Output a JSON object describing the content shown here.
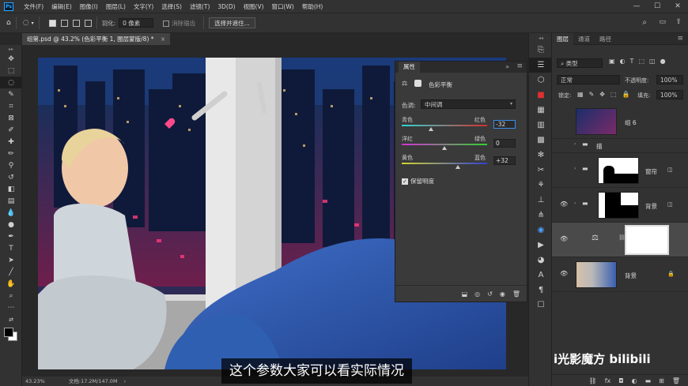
{
  "menubar": {
    "logo": "Ps",
    "items": [
      "文件(F)",
      "编辑(E)",
      "图像(I)",
      "图层(L)",
      "文字(Y)",
      "选择(S)",
      "滤镜(T)",
      "3D(D)",
      "视图(V)",
      "窗口(W)",
      "帮助(H)"
    ],
    "window_controls": [
      "—",
      "☐",
      "✕"
    ]
  },
  "options": {
    "feather_label": "羽化:",
    "feather_value": "0 像素",
    "antialias_label": "消除锯齿",
    "select_mask_button": "选择并遮住..."
  },
  "document": {
    "tab_title": "组第.psd @ 43.2% (色彩平衡 1, 图层蒙版/8) *",
    "tab_close": "×",
    "zoom": "43.23%",
    "doc_info": "文档:17.2M/147.0M"
  },
  "properties": {
    "tab": "属性",
    "title": "色彩平衡",
    "tone_label": "色调:",
    "tone_value": "中间调",
    "sliders": [
      {
        "left": "青色",
        "right": "红色",
        "value": "-32",
        "position": 0.34
      },
      {
        "left": "洋红",
        "right": "绿色",
        "value": "0",
        "position": 0.5
      },
      {
        "left": "黄色",
        "right": "蓝色",
        "value": "+32",
        "position": 0.66
      }
    ],
    "preserve_luminosity": "保留明度"
  },
  "layers_panel": {
    "tabs": [
      "图层",
      "通道",
      "路径"
    ],
    "filter_kind": "类型",
    "blend_mode": "正常",
    "opacity_label": "不透明度:",
    "opacity": "100%",
    "lock_label": "锁定:",
    "fill_label": "填充:",
    "fill": "100%",
    "layers": [
      {
        "name": "组 6"
      },
      {
        "name": "描"
      },
      {
        "name": "窗帘"
      },
      {
        "name": "背景"
      },
      {
        "name": ""
      },
      {
        "name": "背景"
      }
    ]
  },
  "subtitle": "这个参数大家可以看实际情况",
  "watermark": "i光影魔方 bilibili"
}
